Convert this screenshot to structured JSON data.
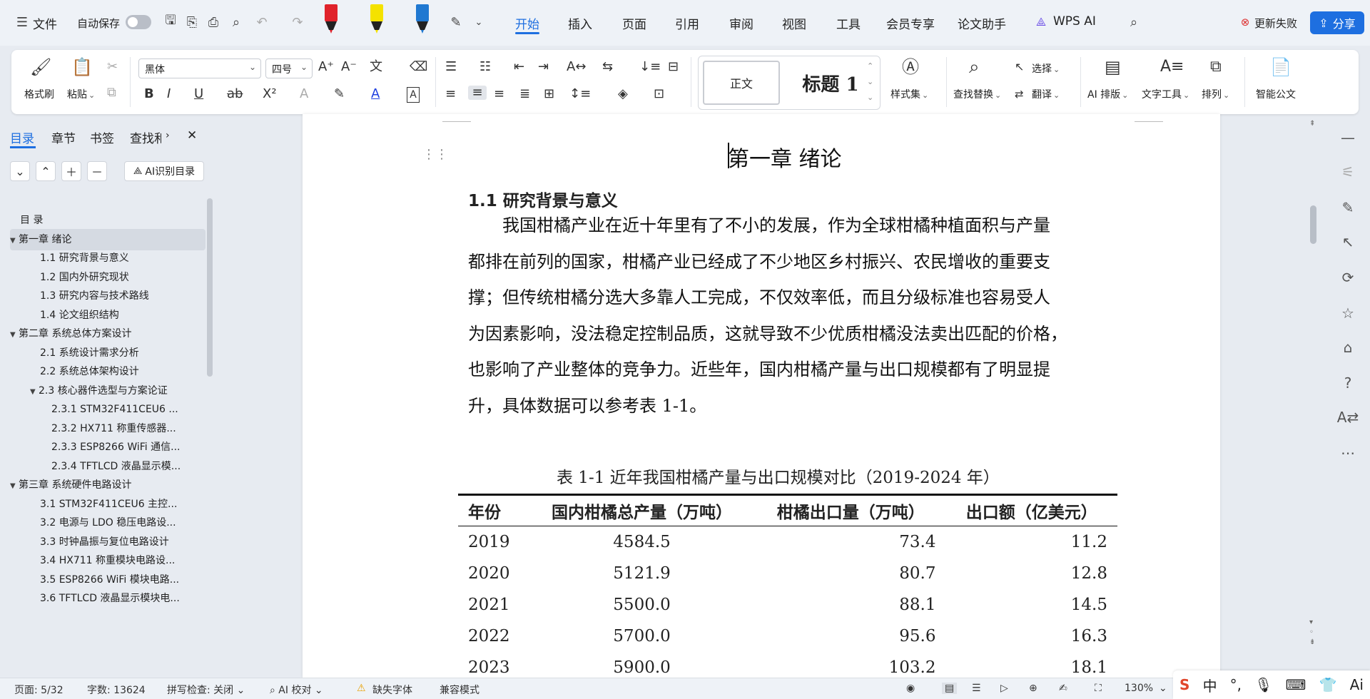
{
  "menubar": {
    "file_menu": "文件",
    "autosave_label": "自动保存",
    "tabs": [
      "开始",
      "插入",
      "页面",
      "引用",
      "审阅",
      "视图",
      "工具",
      "会员专享",
      "论文助手",
      "WPS AI"
    ],
    "active_tab": "开始",
    "update_failed": "更新失败",
    "share_label": "分享"
  },
  "ribbon": {
    "format_painter": "格式刷",
    "paste": "粘贴",
    "font_name": "黑体",
    "font_size": "四号",
    "style_normal": "正文",
    "style_heading1": "标题 1",
    "styles_set": "样式集",
    "find_replace": "查找替换",
    "select": "选择",
    "translate": "翻译",
    "ai_layout": "AI 排版",
    "text_tools": "文字工具",
    "arrange": "排列",
    "smart_doc": "智能公文"
  },
  "nav": {
    "tabs": [
      "目录",
      "章节",
      "书签",
      "查找和"
    ],
    "active_tab": "目录",
    "ai_toc_button": "AI识别目录",
    "toc": [
      {
        "text": "目 录",
        "level": 0,
        "expandable": false
      },
      {
        "text": "第一章  绪论",
        "level": 0,
        "expandable": true,
        "selected": true
      },
      {
        "text": "1.1  研究背景与意义",
        "level": 1,
        "expandable": false
      },
      {
        "text": "1.2  国内外研究现状",
        "level": 1,
        "expandable": false
      },
      {
        "text": "1.3  研究内容与技术路线",
        "level": 1,
        "expandable": false
      },
      {
        "text": "1.4  论文组织结构",
        "level": 1,
        "expandable": false
      },
      {
        "text": "第二章  系统总体方案设计",
        "level": 0,
        "expandable": true
      },
      {
        "text": "2.1  系统设计需求分析",
        "level": 1,
        "expandable": false
      },
      {
        "text": "2.2  系统总体架构设计",
        "level": 1,
        "expandable": false
      },
      {
        "text": "2.3  核心器件选型与方案论证",
        "level": 1,
        "expandable": true
      },
      {
        "text": "2.3.1 STM32F411CEU6 ...",
        "level": 2,
        "expandable": false
      },
      {
        "text": "2.3.2 HX711 称重传感器...",
        "level": 2,
        "expandable": false
      },
      {
        "text": "2.3.3 ESP8266 WiFi 通信...",
        "level": 2,
        "expandable": false
      },
      {
        "text": "2.3.4 TFTLCD 液晶显示模...",
        "level": 2,
        "expandable": false
      },
      {
        "text": "第三章  系统硬件电路设计",
        "level": 0,
        "expandable": true
      },
      {
        "text": "3.1 STM32F411CEU6 主控...",
        "level": 1,
        "expandable": false
      },
      {
        "text": "3.2 电源与 LDO 稳压电路设...",
        "level": 1,
        "expandable": false
      },
      {
        "text": "3.3 时钟晶振与复位电路设计",
        "level": 1,
        "expandable": false
      },
      {
        "text": "3.4 HX711 称重模块电路设...",
        "level": 1,
        "expandable": false
      },
      {
        "text": "3.5 ESP8266 WiFi 模块电路...",
        "level": 1,
        "expandable": false
      },
      {
        "text": "3.6 TFTLCD 液晶显示模块电...",
        "level": 1,
        "expandable": false
      }
    ]
  },
  "document": {
    "chapter_title": "第一章  绪论",
    "section_heading": "1.1  研究背景与意义",
    "paragraph_lines": [
      "我国柑橘产业在近十年里有了不小的发展，作为全球柑橘种植面积与产量",
      "都排在前列的国家，柑橘产业已经成了不少地区乡村振兴、农民增收的重要支",
      "撑；但传统柑橘分选大多靠人工完成，不仅效率低，而且分级标准也容易受人",
      "为因素影响，没法稳定控制品质，这就导致不少优质柑橘没法卖出匹配的价格，",
      "也影响了产业整体的竞争力。近些年，国内柑橘产量与出口规模都有了明显提",
      "升，具体数据可以参考表 1-1。"
    ],
    "table_caption": "表 1-1   近年我国柑橘产量与出口规模对比（2019-2024 年）",
    "table": {
      "headers": [
        "年份",
        "国内柑橘总产量（万吨）",
        "柑橘出口量（万吨）",
        "出口额（亿美元）"
      ],
      "rows": [
        [
          "2019",
          "4584.5",
          "73.4",
          "11.2"
        ],
        [
          "2020",
          "5121.9",
          "80.7",
          "12.8"
        ],
        [
          "2021",
          "5500.0",
          "88.1",
          "14.5"
        ],
        [
          "2022",
          "5700.0",
          "95.6",
          "16.3"
        ],
        [
          "2023",
          "5900.0",
          "103.2",
          "18.1"
        ]
      ]
    }
  },
  "statusbar": {
    "page": "页面: 5/32",
    "words": "字数: 13624",
    "spellcheck": "拼写检查: 关闭",
    "ai_proof": "AI 校对",
    "missing_font": "缺失字体",
    "compat_mode": "兼容模式",
    "zoom": "130%"
  },
  "ime": {
    "chinese_mode": "中"
  },
  "colors": {
    "accent": "#1e6fe0",
    "marker_red": "#e0232b",
    "marker_yellow": "#f4e200",
    "marker_blue": "#1f78d1"
  }
}
